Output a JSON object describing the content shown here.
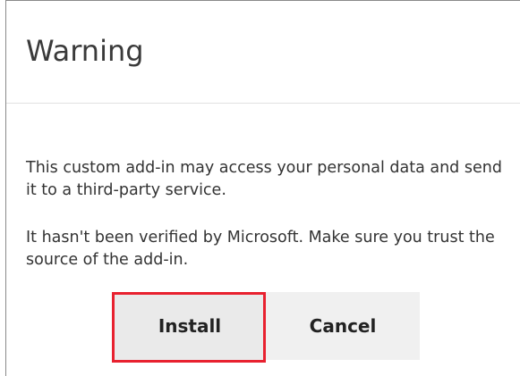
{
  "dialog": {
    "title": "Warning",
    "message_1": "This custom add-in may access your personal data and send it to a third-party service.",
    "message_2": "It hasn't been verified by Microsoft. Make sure you trust the source of the add-in.",
    "buttons": {
      "install_label": "Install",
      "cancel_label": "Cancel"
    }
  },
  "colors": {
    "highlight_border": "#e8212f",
    "button_background": "#f0f0f0",
    "title_text": "#3a3a3a"
  }
}
